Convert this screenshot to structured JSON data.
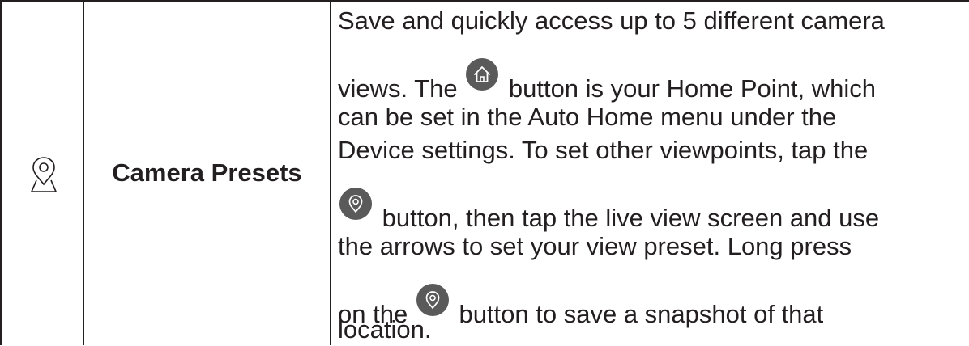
{
  "row": {
    "icon": "map-pin-icon",
    "feature_name": "Camera Presets",
    "description": {
      "line1": "Save and quickly access up to 5 different camera",
      "line2_before": "views. The",
      "line2_after": "button is your Home Point, which",
      "line3": "can be set in the Auto Home menu under the",
      "line4": "Device settings. To set other viewpoints, tap the",
      "line5_after": "button, then tap the live view screen and use",
      "line6": "the arrows to set your view preset. Long press",
      "line7_before": "on the",
      "line7_after": "button to save a snapshot of that",
      "line8": "location."
    },
    "inline_buttons": {
      "home_icon": "home-icon",
      "preset_icon": "location-pin-icon",
      "button_color": "#5a5a5a"
    }
  },
  "colors": {
    "text": "#231f20",
    "rule": "#231f20",
    "background": "#ffffff"
  }
}
